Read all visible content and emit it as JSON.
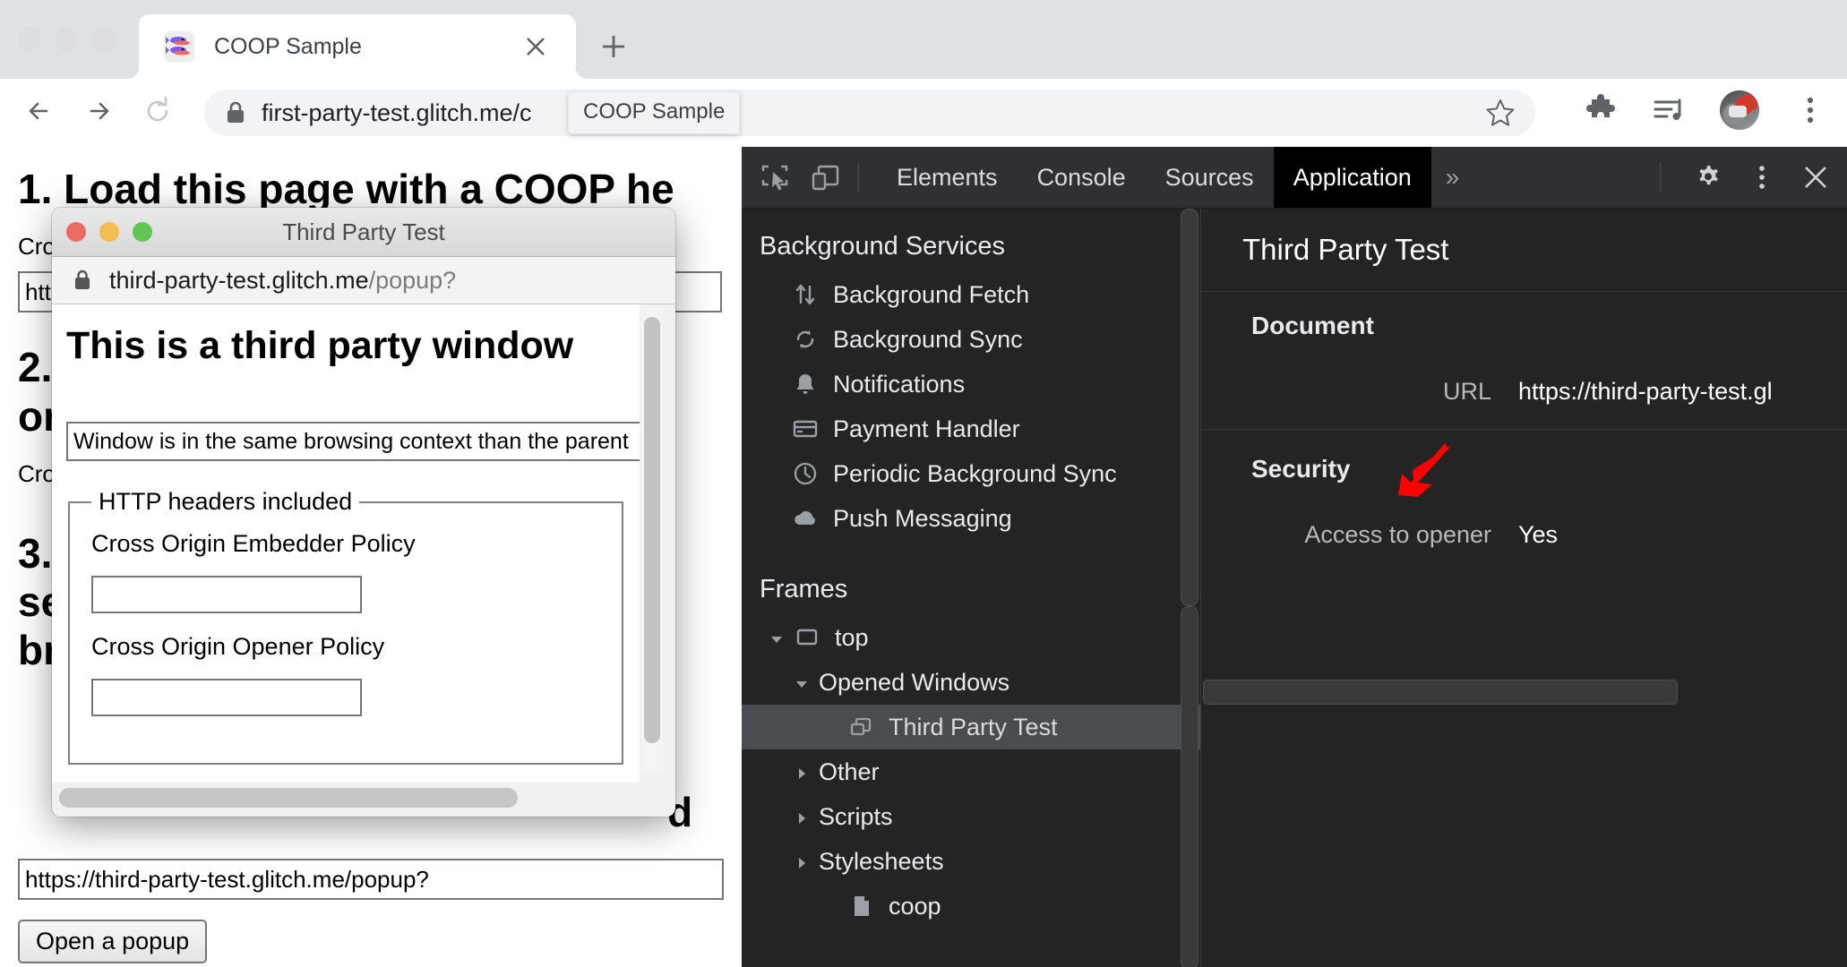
{
  "browser": {
    "tab": {
      "title": "COOP Sample",
      "favicon_icon": "fish-favicon",
      "close_icon": "close-icon"
    },
    "new_tab_icon": "plus-icon",
    "nav": {
      "back_icon": "arrow-left-icon",
      "forward_icon": "arrow-right-icon",
      "reload_icon": "reload-icon"
    },
    "omnibox": {
      "lock_icon": "lock-icon",
      "url": "first-party-test.glitch.me/c",
      "star_icon": "star-icon"
    },
    "tab_tooltip": "COOP Sample",
    "toolbar_icons": [
      "extensions-puzzle-icon",
      "media-list-icon",
      "profile-avatar",
      "three-dot-menu-icon"
    ]
  },
  "page": {
    "heading1": "1. Load this page with a COOP he",
    "label_cross1": "Cro",
    "input_http": "http",
    "heading2": "2.",
    "heading2b": "or",
    "label_cross2": "Cro",
    "heading3": "3.",
    "heading3b": "se",
    "heading3c": "br",
    "heading3_right": "d",
    "popup_url_value": "https://third-party-test.glitch.me/popup?",
    "open_popup_button": "Open a popup"
  },
  "popup": {
    "title": "Third Party Test",
    "lock_icon": "lock-icon",
    "url_host": "third-party-test.glitch.me",
    "url_path": "/popup?",
    "heading": "This is a third party window",
    "status_value": "Window is in the same browsing context than the parent",
    "fieldset_legend": "HTTP headers included",
    "coep_label": "Cross Origin Embedder Policy",
    "coep_value": "",
    "coop_label": "Cross Origin Opener Policy",
    "coop_value": "",
    "traffic_lights": [
      "close-red-dot",
      "minimize-yellow-dot",
      "maximize-green-dot"
    ]
  },
  "devtools": {
    "toolbar": {
      "inspect_icon": "inspect-element-icon",
      "device_icon": "device-toolbar-icon",
      "tabs": [
        {
          "label": "Elements",
          "active": false
        },
        {
          "label": "Console",
          "active": false
        },
        {
          "label": "Sources",
          "active": false
        },
        {
          "label": "Application",
          "active": true
        }
      ],
      "more_tabs_icon": "chevron-double-right-icon",
      "settings_icon": "gear-icon",
      "menu_icon": "three-dot-menu-icon",
      "close_icon": "close-icon"
    },
    "sidebar": {
      "background_services_title": "Background Services",
      "background_services": [
        {
          "label": "Background Fetch",
          "icon": "up-down-arrows-icon"
        },
        {
          "label": "Background Sync",
          "icon": "sync-refresh-icon"
        },
        {
          "label": "Notifications",
          "icon": "bell-icon"
        },
        {
          "label": "Payment Handler",
          "icon": "credit-card-icon"
        },
        {
          "label": "Periodic Background Sync",
          "icon": "clock-icon"
        },
        {
          "label": "Push Messaging",
          "icon": "cloud-icon"
        }
      ],
      "frames_title": "Frames",
      "frames": [
        {
          "label": "top",
          "icon": "frame-icon",
          "caret": "down",
          "indent": 2,
          "selected": false
        },
        {
          "label": "Opened Windows",
          "icon": "none",
          "caret": "down",
          "indent": 3,
          "selected": false
        },
        {
          "label": "Third Party Test",
          "icon": "windows-stack-icon",
          "caret": "none",
          "indent": 4,
          "selected": true
        },
        {
          "label": "Other",
          "icon": "none",
          "caret": "right",
          "indent": 3,
          "selected": false
        },
        {
          "label": "Scripts",
          "icon": "none",
          "caret": "right",
          "indent": 3,
          "selected": false
        },
        {
          "label": "Stylesheets",
          "icon": "none",
          "caret": "right",
          "indent": 3,
          "selected": false
        },
        {
          "label": "coop",
          "icon": "document-file-icon",
          "caret": "none",
          "indent": 4,
          "selected": false
        }
      ]
    },
    "content": {
      "header_title": "Third Party Test",
      "document_section": "Document",
      "url_key": "URL",
      "url_value": "https://third-party-test.gl",
      "security_section": "Security",
      "opener_key": "Access to opener",
      "opener_value": "Yes",
      "annotation_arrow_color": "#ff0000"
    }
  }
}
